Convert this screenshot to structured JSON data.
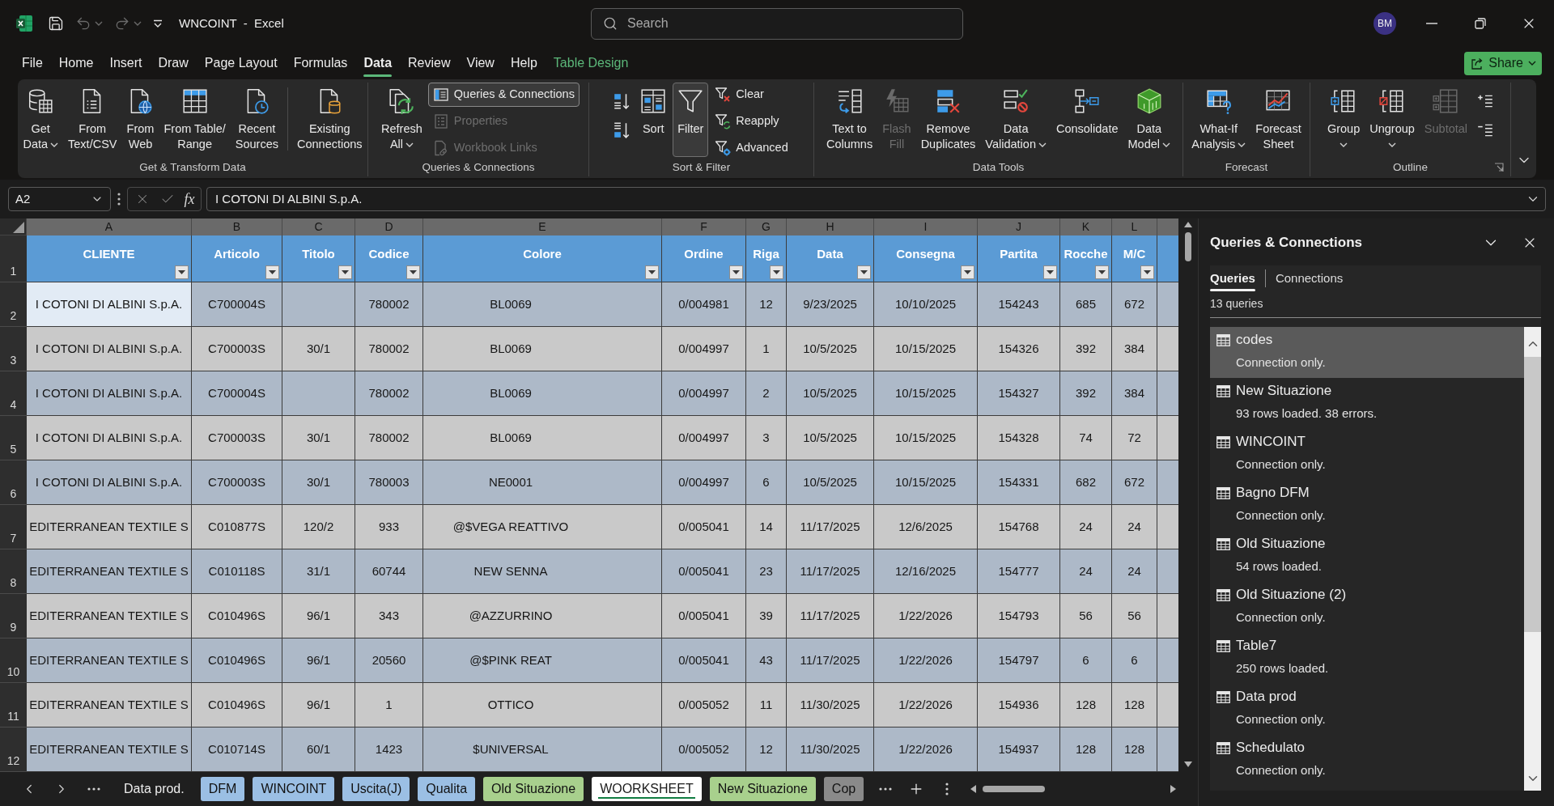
{
  "title": "WNCOINT  -  Excel",
  "quick_access": [
    {
      "disabled": false,
      "dropdown": false
    },
    {
      "disabled": true,
      "dropdown": true
    },
    {
      "disabled": true,
      "dropdown": true
    },
    {
      "disabled": false,
      "dropdown": false
    }
  ],
  "search": {
    "placeholder": "Search"
  },
  "account": {
    "initials": "BM"
  },
  "ribbon_tabs": [
    {
      "label": "File",
      "selected": false,
      "kind": "standard"
    },
    {
      "label": "Home",
      "selected": false,
      "kind": "standard"
    },
    {
      "label": "Insert",
      "selected": false,
      "kind": "standard"
    },
    {
      "label": "Draw",
      "selected": false,
      "kind": "standard"
    },
    {
      "label": "Page Layout",
      "selected": false,
      "kind": "standard"
    },
    {
      "label": "Formulas",
      "selected": false,
      "kind": "standard"
    },
    {
      "label": "Data",
      "selected": true,
      "kind": "standard"
    },
    {
      "label": "Review",
      "selected": false,
      "kind": "standard"
    },
    {
      "label": "View",
      "selected": false,
      "kind": "standard"
    },
    {
      "label": "Help",
      "selected": false,
      "kind": "standard"
    },
    {
      "label": "Table Design",
      "selected": false,
      "kind": "contextual"
    }
  ],
  "share_button": {
    "label": "Share",
    "dropdown": true
  },
  "ribbon": {
    "groups": [
      {
        "label": "Get & Transform Data",
        "dialog_launcher": false,
        "buttons": [
          {
            "kind": "large",
            "lines": [
              "Get",
              "Data"
            ],
            "dropdown": true,
            "disabled": false,
            "on": false
          },
          {
            "kind": "large",
            "lines": [
              "From",
              "Text/CSV"
            ],
            "dropdown": false,
            "disabled": false,
            "on": false
          },
          {
            "kind": "large",
            "lines": [
              "From",
              "Web"
            ],
            "dropdown": false,
            "disabled": false,
            "on": false
          },
          {
            "kind": "large",
            "lines": [
              "From Table/",
              "Range"
            ],
            "dropdown": false,
            "disabled": false,
            "on": false
          },
          {
            "kind": "large",
            "lines": [
              "Recent",
              "Sources"
            ],
            "dropdown": false,
            "disabled": false,
            "on": false
          },
          {
            "kind": "divider"
          },
          {
            "kind": "large",
            "lines": [
              "Existing",
              "Connections"
            ],
            "dropdown": false,
            "disabled": false,
            "on": false
          }
        ]
      },
      {
        "label": "Queries & Connections",
        "dialog_launcher": false,
        "buttons": [
          {
            "kind": "large",
            "lines": [
              "Refresh",
              "All"
            ],
            "dropdown": true,
            "disabled": false,
            "on": false
          },
          {
            "kind": "stack",
            "items": [
              {
                "label": "Queries & Connections",
                "disabled": false,
                "on": true
              },
              {
                "label": "Properties",
                "disabled": true,
                "on": false
              },
              {
                "label": "Workbook Links",
                "disabled": true,
                "on": false
              }
            ]
          }
        ]
      },
      {
        "label": "Sort & Filter",
        "dialog_launcher": false,
        "buttons": [
          {
            "kind": "icon_stack",
            "items": [
              {
                "disabled": false,
                "on": false
              },
              {
                "disabled": false,
                "on": false
              }
            ]
          },
          {
            "kind": "large",
            "lines": [
              "Sort"
            ],
            "dropdown": false,
            "disabled": false,
            "on": false
          },
          {
            "kind": "large",
            "lines": [
              "Filter"
            ],
            "dropdown": false,
            "disabled": false,
            "on": true
          },
          {
            "kind": "stack",
            "items": [
              {
                "label": "Clear",
                "disabled": false,
                "on": false
              },
              {
                "label": "Reapply",
                "disabled": false,
                "on": false
              },
              {
                "label": "Advanced",
                "disabled": false,
                "on": false
              }
            ]
          }
        ]
      },
      {
        "label": "Data Tools",
        "dialog_launcher": false,
        "buttons": [
          {
            "kind": "large",
            "lines": [
              "Text to",
              "Columns"
            ],
            "dropdown": false,
            "disabled": false,
            "on": false
          },
          {
            "kind": "large",
            "lines": [
              "Flash",
              "Fill"
            ],
            "dropdown": false,
            "disabled": true,
            "on": false
          },
          {
            "kind": "large",
            "lines": [
              "Remove",
              "Duplicates"
            ],
            "dropdown": false,
            "disabled": false,
            "on": false
          },
          {
            "kind": "large",
            "lines": [
              "Data",
              "Validation"
            ],
            "dropdown": true,
            "disabled": false,
            "on": false
          },
          {
            "kind": "large",
            "lines": [
              "Consolidate"
            ],
            "dropdown": false,
            "disabled": false,
            "on": false
          },
          {
            "kind": "large",
            "lines": [
              "Data",
              "Model"
            ],
            "dropdown": true,
            "disabled": false,
            "on": false
          }
        ]
      },
      {
        "label": "Forecast",
        "dialog_launcher": false,
        "buttons": [
          {
            "kind": "large",
            "lines": [
              "What-If",
              "Analysis"
            ],
            "dropdown": true,
            "disabled": false,
            "on": false
          },
          {
            "kind": "large",
            "lines": [
              "Forecast",
              "Sheet"
            ],
            "dropdown": false,
            "disabled": false,
            "on": false
          }
        ]
      },
      {
        "label": "Outline",
        "dialog_launcher": true,
        "buttons": [
          {
            "kind": "large",
            "lines": [
              "Group"
            ],
            "dropdown": true,
            "disabled": false,
            "on": false
          },
          {
            "kind": "large",
            "lines": [
              "Ungroup"
            ],
            "dropdown": true,
            "disabled": false,
            "on": false
          },
          {
            "kind": "large",
            "lines": [
              "Subtotal"
            ],
            "dropdown": false,
            "disabled": true,
            "on": false
          },
          {
            "kind": "icon_stack",
            "items": [
              {
                "disabled": false,
                "on": false
              },
              {
                "disabled": false,
                "on": false
              }
            ]
          }
        ]
      }
    ]
  },
  "formula_bar": {
    "name_box": "A2",
    "function_label": "fx",
    "formula": "I COTONI DI ALBINI S.p.A."
  },
  "sheet": {
    "columns": [
      {
        "letter": "A",
        "header": "CLIENTE"
      },
      {
        "letter": "B",
        "header": "Articolo"
      },
      {
        "letter": "C",
        "header": "Titolo"
      },
      {
        "letter": "D",
        "header": "Codice"
      },
      {
        "letter": "E",
        "header": "Colore"
      },
      {
        "letter": "F",
        "header": "Ordine"
      },
      {
        "letter": "G",
        "header": "Riga"
      },
      {
        "letter": "H",
        "header": "Data"
      },
      {
        "letter": "I",
        "header": "Consegna"
      },
      {
        "letter": "J",
        "header": "Partita"
      },
      {
        "letter": "K",
        "header": "Rocche"
      },
      {
        "letter": "L",
        "header": "M/C"
      }
    ],
    "header_row": "1",
    "rows": [
      {
        "number": "2",
        "selected": true,
        "cells": [
          "I COTONI DI ALBINI S.p.A.",
          "C700004S",
          null,
          "780002",
          "BL0069",
          "0/004981",
          "12",
          "9/23/2025",
          "10/10/2025",
          "154243",
          "685",
          "672"
        ]
      },
      {
        "number": "3",
        "selected": false,
        "cells": [
          "I COTONI DI ALBINI S.p.A.",
          "C700003S",
          "30/1",
          "780002",
          "BL0069",
          "0/004997",
          "1",
          "10/5/2025",
          "10/15/2025",
          "154326",
          "392",
          "384"
        ]
      },
      {
        "number": "4",
        "selected": false,
        "cells": [
          "I COTONI DI ALBINI S.p.A.",
          "C700004S",
          null,
          "780002",
          "BL0069",
          "0/004997",
          "2",
          "10/5/2025",
          "10/15/2025",
          "154327",
          "392",
          "384"
        ]
      },
      {
        "number": "5",
        "selected": false,
        "cells": [
          "I COTONI DI ALBINI S.p.A.",
          "C700003S",
          "30/1",
          "780002",
          "BL0069",
          "0/004997",
          "3",
          "10/5/2025",
          "10/15/2025",
          "154328",
          "74",
          "72"
        ]
      },
      {
        "number": "6",
        "selected": false,
        "cells": [
          "I COTONI DI ALBINI S.p.A.",
          "C700003S",
          "30/1",
          "780003",
          "NE0001",
          "0/004997",
          "6",
          "10/5/2025",
          "10/15/2025",
          "154331",
          "682",
          "672"
        ]
      },
      {
        "number": "7",
        "selected": false,
        "cells": [
          "EDITERRANEAN TEXTILE S",
          "C010877S",
          "120/2",
          "933",
          "@$VEGA REATTIVO",
          "0/005041",
          "14",
          "11/17/2025",
          "12/6/2025",
          "154768",
          "24",
          "24"
        ]
      },
      {
        "number": "8",
        "selected": false,
        "cells": [
          "EDITERRANEAN TEXTILE S",
          "C010118S",
          "31/1",
          "60744",
          "NEW SENNA",
          "0/005041",
          "23",
          "11/17/2025",
          "12/16/2025",
          "154777",
          "24",
          "24"
        ]
      },
      {
        "number": "9",
        "selected": false,
        "cells": [
          "EDITERRANEAN TEXTILE S",
          "C010496S",
          "96/1",
          "343",
          "@AZZURRINO",
          "0/005041",
          "39",
          "11/17/2025",
          "1/22/2026",
          "154793",
          "56",
          "56"
        ]
      },
      {
        "number": "10",
        "selected": false,
        "cells": [
          "EDITERRANEAN TEXTILE S",
          "C010496S",
          "96/1",
          "20560",
          "@$PINK REAT",
          "0/005041",
          "43",
          "11/17/2025",
          "1/22/2026",
          "154797",
          "6",
          "6"
        ]
      },
      {
        "number": "11",
        "selected": false,
        "cells": [
          "EDITERRANEAN TEXTILE S",
          "C010496S",
          "96/1",
          "1",
          "OTTICO",
          "0/005052",
          "11",
          "11/30/2025",
          "1/22/2026",
          "154936",
          "128",
          "128"
        ]
      },
      {
        "number": "12",
        "selected": false,
        "cells": [
          "EDITERRANEAN TEXTILE S",
          "C010714S",
          "60/1",
          "1423",
          "$UNIVERSAL",
          "0/005052",
          "12",
          "11/30/2025",
          "1/22/2026",
          "154937",
          "128",
          "128"
        ]
      }
    ]
  },
  "sheet_tabs": [
    {
      "label": "Data prod.",
      "selected": false
    },
    {
      "label": "DFM",
      "selected": false,
      "color": "#9bbfe4"
    },
    {
      "label": "WINCOINT",
      "selected": false,
      "color": "#9bbfe4"
    },
    {
      "label": "Uscita(J)",
      "selected": false,
      "color": "#9bbfe4"
    },
    {
      "label": "Qualita",
      "selected": false,
      "color": "#9bbfe4"
    },
    {
      "label": "Old Situazione",
      "selected": false,
      "color": "#a8d08d"
    },
    {
      "label": "WOORKSHEET",
      "selected": true
    },
    {
      "label": "New Situazione",
      "selected": false,
      "color": "#a8d08d"
    },
    {
      "label": "Cop",
      "selected": false,
      "color": "#8a8a8a"
    }
  ],
  "queries_panel": {
    "title": "Queries & Connections",
    "tabs": [
      {
        "label": "Queries",
        "selected": true
      },
      {
        "label": "Connections",
        "selected": false
      }
    ],
    "count": "13 queries",
    "queries": [
      {
        "name": "codes",
        "status": "Connection only.",
        "selected": true
      },
      {
        "name": "New Situazione",
        "status": "93 rows loaded. 38 errors.",
        "selected": false
      },
      {
        "name": "WINCOINT",
        "status": "Connection only.",
        "selected": false
      },
      {
        "name": "Bagno DFM",
        "status": "Connection only.",
        "selected": false
      },
      {
        "name": "Old Situazione",
        "status": "54 rows loaded.",
        "selected": false
      },
      {
        "name": "Old Situazione (2)",
        "status": "Connection only.",
        "selected": false
      },
      {
        "name": "Table7",
        "status": "250 rows loaded.",
        "selected": false
      },
      {
        "name": "Data prod",
        "status": "Connection only.",
        "selected": false
      },
      {
        "name": "Schedulato",
        "status": "Connection only.",
        "selected": false
      }
    ]
  }
}
